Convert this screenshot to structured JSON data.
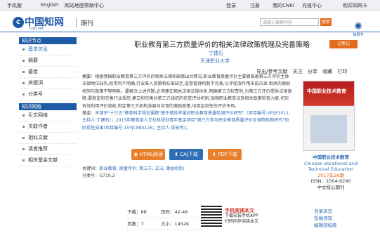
{
  "topbar": {
    "items": [
      "手机版",
      "English",
      "网站地图",
      "帮助中心",
      "登录",
      "注册",
      "我的CNKI",
      "充值中心",
      "购买知网卡"
    ]
  },
  "header": {
    "logo_text": "中国知网",
    "logo_sub": "cnki.net",
    "section": "期刊",
    "search_placeholder": "请输入搜索内容",
    "search_btn": "搜索",
    "badge_text": "知网节"
  },
  "sidebar": {
    "group1": "知识节点",
    "items1": [
      "基本信息",
      "摘要",
      "基金",
      "关键词",
      "分类号"
    ],
    "group2": "知识网络",
    "items2": [
      "引文网络",
      "关联作者",
      "相似文献",
      "读者推荐",
      "相关基金文献"
    ]
  },
  "article": {
    "title": "职业教育第三方质量评价的相关法律政策梳理及完善策略",
    "author": "丁建石",
    "institution": "天津职业大学",
    "recommend_btn": "记笔记",
    "toolbar": [
      "导出/参考文献",
      "关注",
      "分享",
      "收藏",
      "打印"
    ],
    "abstract_label": "摘要：",
    "abstract": "根据我国职业教育第三方评价的相关法律和政策出台情况,职业教育质量评价主要面临着第三方评价主体法律地位缺失,权责利不明确,行业准入资质和标准缺乏,监督管理机制不完善,以评促改作用未能凸显,相关的激励机制与政策不够明晰。要解决上述问题,必须建立相关法律法规体系,明确第三方权责利,为第三方评价提供法律保障;要制定和完善行业规范,建立和完善对第三方组织的信誉评估机制,加强职业教育法及相关政策检查力度,切实有效利用评价效能;制定第三方机构发展与培育的激励政策,培育起良性的评估市场。",
    "fund_label": "基金：",
    "fund": "天津市\"十三五\"教育科学规划课题\"基于绩效考量的职业教育质量检测评价研究\"（项目编号:VESP1011,主持人:丁建石）；2015年教育部人文社科规划青年基金项目\"第三方参与职业教育质量评价及保障机制研究\"的阶段性成果(项目编号:15YJC880126；主持人:张宏亮)；",
    "keywords_label": "关键词：",
    "keywords": "职业教育; 质量评价; 第三方; 立法; 激励机制;",
    "class_label": "分类号：",
    "class_no": "G719.2"
  },
  "journal": {
    "cover_title": "中国职业技术教育",
    "name": "中国职业技术教育",
    "english": "Chinese Vocational and Technical Education",
    "issue": "2017年26期",
    "issn": "ISSN：1004-9290",
    "cnki_core": "中文核心期刊"
  },
  "downloads": {
    "html": "HTML阅读",
    "caj": "CAJ下载",
    "pdf": "PDF下载"
  },
  "stats": {
    "downloads_label": "下载：",
    "downloads": "68",
    "pages_label": "页码：",
    "pages": "42-48",
    "page_count_label": "页数：",
    "page_count": "7",
    "size_label": "大小：",
    "size": "1452K"
  },
  "mobile": {
    "title": "手机阅读本文",
    "line1": "下载安装手机APP",
    "line2": "扫码同步阅读本文"
  },
  "right_links": [
    "目录浏览",
    "投稿须知",
    "编辑部指南"
  ]
}
